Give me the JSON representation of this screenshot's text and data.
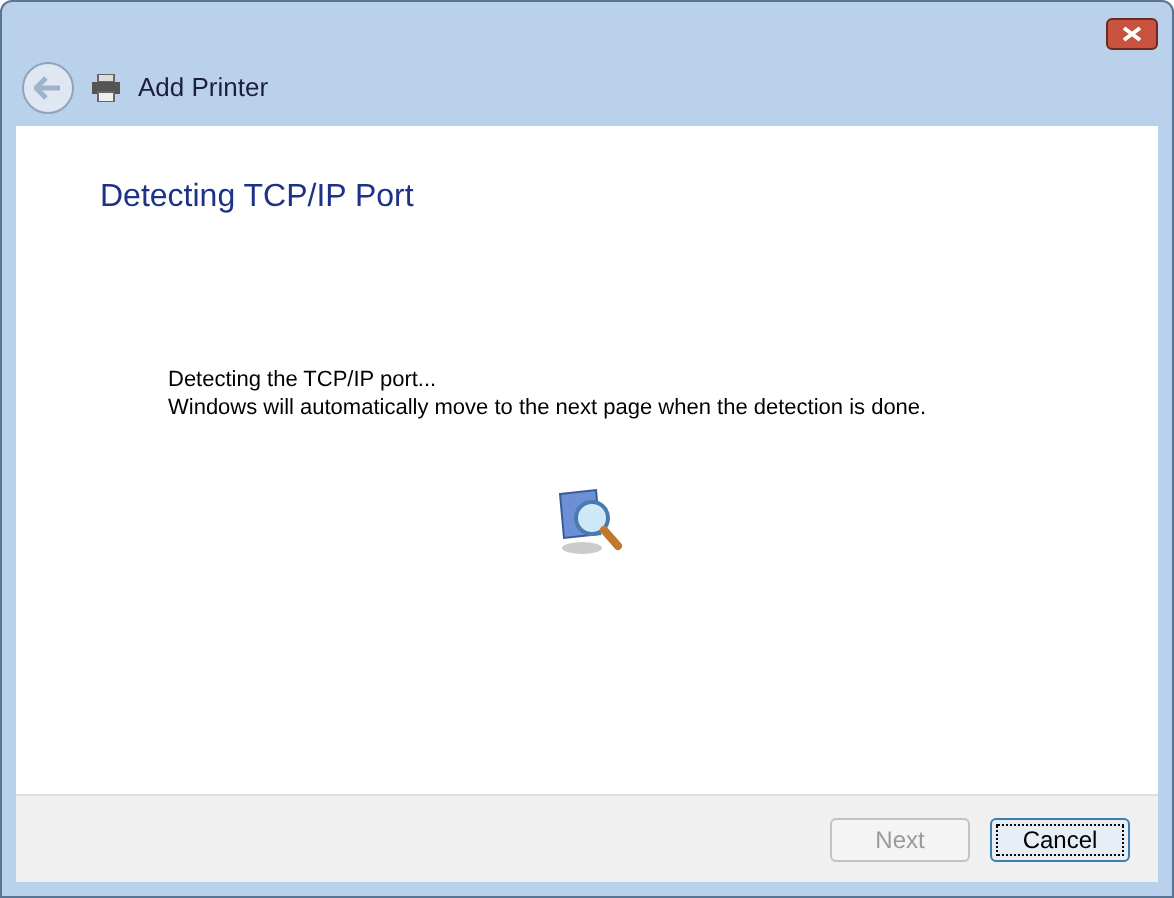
{
  "window": {
    "title": "Add Printer"
  },
  "heading": "Detecting TCP/IP Port",
  "message": [
    "Detecting the TCP/IP port...",
    "Windows will automatically move to the next page when the detection is done."
  ],
  "buttons": [
    {
      "label": "Next",
      "disabled": true,
      "focused": false
    },
    {
      "label": "Cancel",
      "disabled": false,
      "focused": true
    }
  ]
}
